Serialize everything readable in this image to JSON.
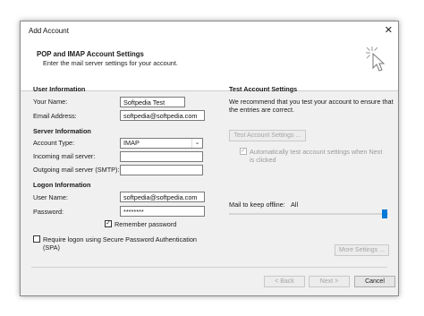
{
  "window": {
    "title": "Add Account",
    "close_glyph": "✕"
  },
  "header": {
    "title": "POP and IMAP Account Settings",
    "subtitle": "Enter the mail server settings for your account."
  },
  "user_info": {
    "heading": "User Information",
    "your_name_label": "Your Name:",
    "your_name_value": "Softpedia Test",
    "email_label": "Email Address:",
    "email_value": "softpedia@softpedia.com"
  },
  "server_info": {
    "heading": "Server Information",
    "account_type_label": "Account Type:",
    "account_type_value": "IMAP",
    "incoming_label": "Incoming mail server:",
    "incoming_value": "",
    "outgoing_label": "Outgoing mail server (SMTP):",
    "outgoing_value": ""
  },
  "logon_info": {
    "heading": "Logon Information",
    "username_label": "User Name:",
    "username_value": "softpedia@softpedia.com",
    "password_label": "Password:",
    "password_value": "********",
    "remember_label": "Remember password",
    "remember_checked": true,
    "spa_label_line1": "Require logon using Secure Password Authentication",
    "spa_label_line2": "(SPA)",
    "spa_checked": false
  },
  "test_settings": {
    "heading": "Test Account Settings",
    "desc_line1": "We recommend that you test your account to ensure that",
    "desc_line2": "the entries are correct.",
    "test_button": "Test Account Settings ...",
    "auto_test_line1": "Automatically test account settings when Next",
    "auto_test_line2": "is clicked",
    "auto_test_checked": true
  },
  "offline": {
    "label": "Mail to keep offline:",
    "value": "All"
  },
  "more_settings_button": "More Settings ...",
  "footer": {
    "back_button": "< Back",
    "next_button": "Next >",
    "cancel_button": "Cancel"
  },
  "colors": {
    "accent": "#0078d7",
    "dialog_bg": "#f0f0f0"
  }
}
